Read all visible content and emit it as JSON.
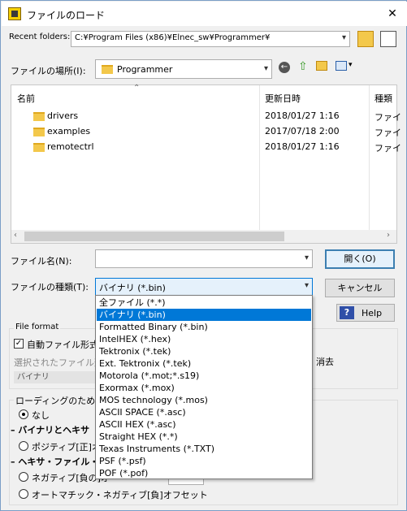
{
  "window": {
    "title": "ファイルのロード",
    "close_glyph": "✕"
  },
  "recent": {
    "label": "Recent folders:",
    "value": "C:¥Program Files (x86)¥Elnec_sw¥Programmer¥"
  },
  "location": {
    "label": "ファイルの場所(I):",
    "value": "Programmer"
  },
  "list": {
    "columns": [
      "名前",
      "更新日時",
      "種類"
    ],
    "rows": [
      {
        "name": "drivers",
        "date": "2018/01/27 1:16",
        "type": "ファイ"
      },
      {
        "name": "examples",
        "date": "2017/07/18 2:00",
        "type": "ファイ"
      },
      {
        "name": "remotectrl",
        "date": "2018/01/27 1:16",
        "type": "ファイ"
      }
    ]
  },
  "filename": {
    "label": "ファイル名(N):",
    "value": ""
  },
  "filetype": {
    "label": "ファイルの種類(T):",
    "value": "バイナリ (*.bin)"
  },
  "buttons": {
    "open": "開く(O)",
    "cancel": "キャンセル",
    "help": "Help"
  },
  "format": {
    "group_label": "File format",
    "auto_check": "自動ファイル形式認",
    "selected_label": "選択されたファイル形",
    "selected_value": "バイナリ",
    "trailing": "消去"
  },
  "loading": {
    "group_label": "ローディングのための",
    "radio_none": "なし",
    "section_binary": "バイナリとヘキサ",
    "radio_positive": "ポジティブ[正]オフ",
    "section_hex": "ヘキサ・ファイル・",
    "radio_negative": "ネガティブ[負の]オ",
    "radio_auto": "オートマチック・ネガティブ[負]オフセット"
  },
  "dropdown_options": [
    "全ファイル (*.*)",
    "バイナリ (*.bin)",
    "Formatted Binary (*.bin)",
    "IntelHEX (*.hex)",
    "Tektronix (*.tek)",
    "Ext. Tektronix (*.tek)",
    "Motorola (*.mot;*.s19)",
    "Exormax (*.mox)",
    "MOS technology (*.mos)",
    "ASCII SPACE (*.asc)",
    "ASCII HEX (*.asc)",
    "Straight HEX (*.*)",
    "Texas Instruments (*.TXT)",
    "PSF (*.psf)",
    "POF (*.pof)"
  ],
  "selected_option": "バイナリ (*.bin)",
  "colors": {
    "accent": "#0078d7",
    "folder": "#f3c84b"
  }
}
